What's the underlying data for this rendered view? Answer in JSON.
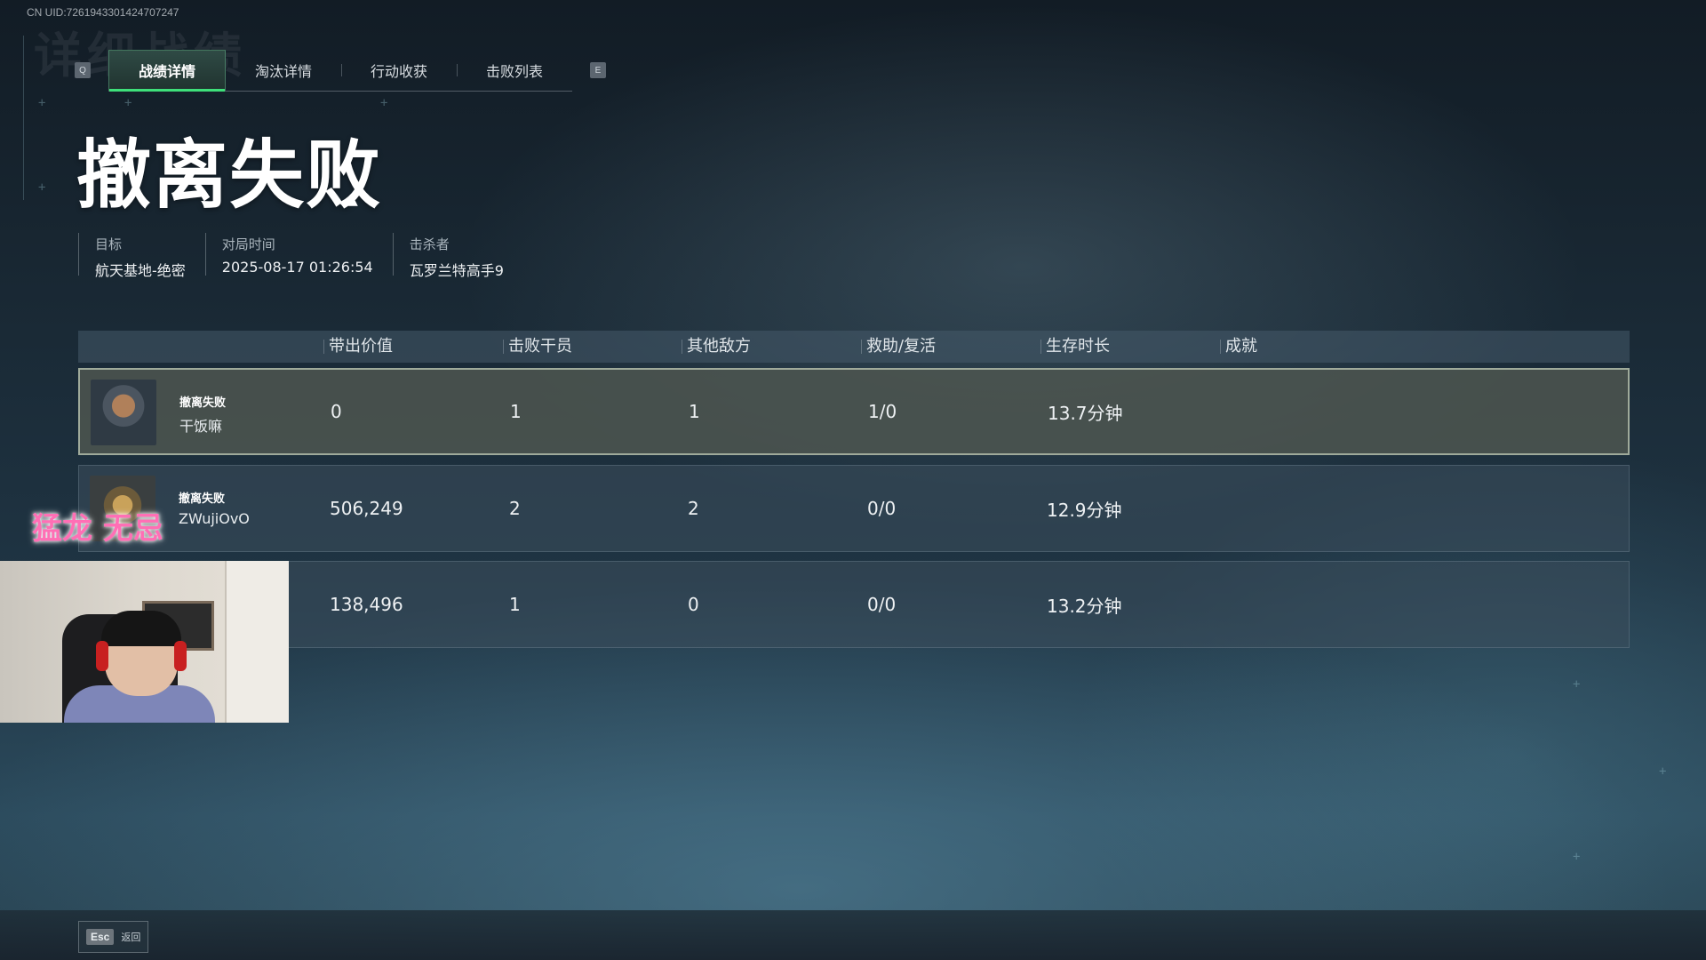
{
  "header": {
    "uid": "CN UID:7261943301424707247",
    "ghost_title": "详细战绩"
  },
  "tabs": {
    "left_key": "Q",
    "right_key": "E",
    "items": [
      {
        "label": "战绩详情",
        "active": true
      },
      {
        "label": "淘汰详情",
        "active": false
      },
      {
        "label": "行动收获",
        "active": false
      },
      {
        "label": "击败列表",
        "active": false
      }
    ]
  },
  "result": {
    "title": "撤离失败"
  },
  "info": {
    "target_label": "目标",
    "target_value": "航天基地-绝密",
    "time_label": "对局时间",
    "time_value": "2025-08-17 01:26:54",
    "killer_label": "击杀者",
    "killer_value": "瓦罗兰特高手9"
  },
  "table": {
    "columns": [
      "带出价值",
      "击败干员",
      "其他敌方",
      "救助/复活",
      "生存时长",
      "成就"
    ],
    "rows": [
      {
        "status": "撤离失败",
        "name": "干饭嘛",
        "value": "0",
        "kills": "1",
        "other": "1",
        "assist": "1/0",
        "survival": "13.7分钟",
        "selected": true,
        "avatar": "soldier-cap-avatar"
      },
      {
        "status": "撤离失败",
        "name": "ZWujiOvO",
        "value": "506,249",
        "kills": "2",
        "other": "2",
        "assist": "0/0",
        "survival": "12.9分钟",
        "selected": false,
        "avatar": "crowned-avatar"
      },
      {
        "status": "",
        "name": "",
        "value": "138,496",
        "kills": "1",
        "other": "0",
        "assist": "0/0",
        "survival": "13.2分钟",
        "selected": false,
        "avatar": ""
      }
    ]
  },
  "overlay": {
    "streamer_text": "猛龙 无忌"
  },
  "footer": {
    "esc_key": "Esc",
    "esc_label": "返回"
  },
  "colors": {
    "accent_green": "#3ee07a",
    "overlay_pink": "#ff6fb5"
  }
}
